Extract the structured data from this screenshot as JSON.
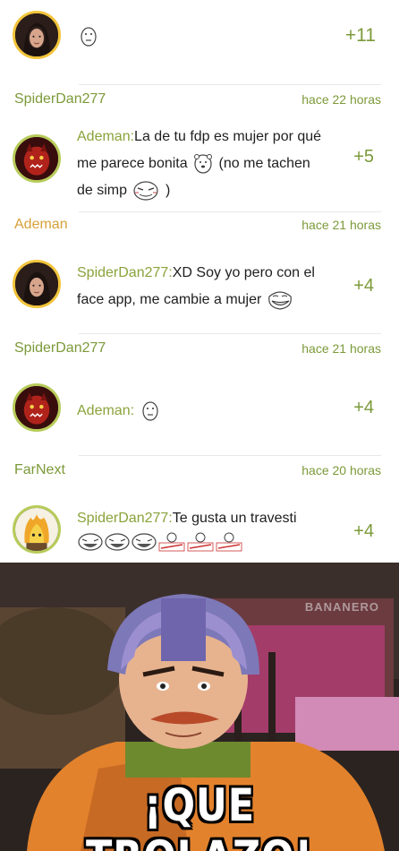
{
  "comments": [
    {
      "mention": "",
      "text": "",
      "score": "+11",
      "avatar_icon": "woman-portrait-avatar",
      "face_icons": [
        "troll-face-neutral-icon"
      ]
    },
    {
      "meta_user": "SpiderDan277",
      "meta_time": "hace 22 horas",
      "mention": "Ademan:",
      "text_a": "La de tu fdp es mujer por qué me parece bonita",
      "text_b": "(no me tachen de simp",
      "text_c": ")",
      "score": "+5",
      "avatar_icon": "red-demon-avatar",
      "face_icons": [
        "pedobear-face-icon",
        "rage-blush-face-icon"
      ]
    },
    {
      "meta_user": "Ademan",
      "meta_time": "hace 21 horas",
      "mention": "SpiderDan277:",
      "text": "XD Soy yo pero con el face app, me cambie a mujer",
      "score": "+4",
      "avatar_icon": "woman-portrait-avatar",
      "face_icons": [
        "troll-face-icon"
      ]
    },
    {
      "meta_user": "SpiderDan277",
      "meta_time": "hace 21 horas",
      "mention": "Ademan:",
      "text": "",
      "score": "+4",
      "avatar_icon": "red-demon-avatar",
      "face_icons": [
        "neutral-face-icon"
      ]
    },
    {
      "meta_user": "FarNext",
      "meta_time": "hace 20 horas",
      "mention": "SpiderDan277:",
      "text": "Te gusta un travesti",
      "score": "+4",
      "avatar_icon": "flame-head-avatar",
      "face_icons": [
        "laughing-face-icon",
        "laughing-face-icon",
        "laughing-face-icon",
        "gtfo-face-icon",
        "gtfo-face-icon",
        "gtfo-face-icon"
      ]
    }
  ],
  "meme": {
    "watermark": "BANANERO",
    "caption": "¡QUE TROLAZO!"
  },
  "colors": {
    "username_green": "#7c9a3a",
    "username_orange": "#d7a03a",
    "mention": "#8aa33b",
    "avatar_ring_gold": "#f2c43a",
    "avatar_ring_green": "#b8cc5a"
  }
}
